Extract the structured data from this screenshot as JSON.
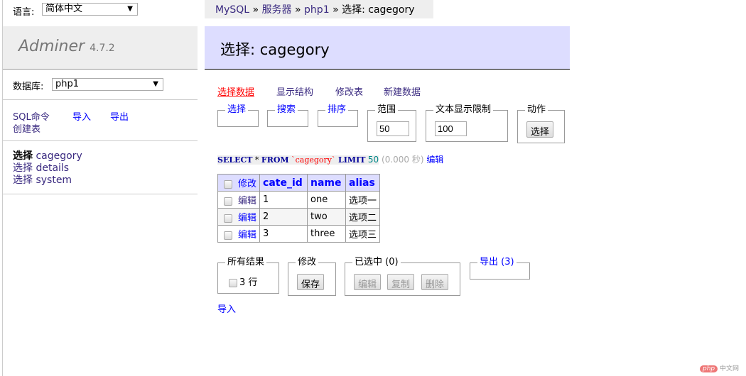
{
  "sidebar": {
    "lang_label": "语言:",
    "lang_value": "简体中文",
    "logo": "Adminer",
    "version": "4.7.2",
    "db_label": "数据库:",
    "db_value": "php1",
    "links": [
      "SQL命令",
      "导入",
      "导出",
      "创建表"
    ],
    "tables": [
      {
        "action": "选择",
        "name": "cagegory"
      },
      {
        "action": "选择",
        "name": "details"
      },
      {
        "action": "选择",
        "name": "system"
      }
    ]
  },
  "breadcrumb": {
    "items": [
      "MySQL",
      "服务器",
      "php1"
    ],
    "sep": "»",
    "current": "选择: cagegory"
  },
  "title": "选择: cagegory",
  "tabs": [
    "选择数据",
    "显示结构",
    "修改表",
    "新建数据"
  ],
  "filters": {
    "select": "选择",
    "search": "搜索",
    "sort": "排序",
    "limit_label": "范围",
    "limit_value": "50",
    "text_label": "文本显示限制",
    "text_value": "100",
    "action_label": "动作",
    "action_button": "选择"
  },
  "query": {
    "select": "SELECT",
    "star": "*",
    "from": "FROM",
    "table": "`cagegory`",
    "limit": "LIMIT",
    "limit_value": "50",
    "time": "(0.000 秒)",
    "edit": "编辑"
  },
  "table": {
    "modify_header": "修改",
    "columns": [
      "cate_id",
      "name",
      "alias"
    ],
    "rows": [
      {
        "edit": "编辑",
        "cells": [
          "1",
          "one",
          "选项一"
        ]
      },
      {
        "edit": "编辑",
        "cells": [
          "2",
          "two",
          "选项二"
        ]
      },
      {
        "edit": "编辑",
        "cells": [
          "3",
          "three",
          "选项三"
        ]
      }
    ]
  },
  "bottom": {
    "all_label": "所有结果",
    "rows_label": "3 行",
    "modify_label": "修改",
    "save": "保存",
    "selected_label": "已选中 (0)",
    "edit": "编辑",
    "copy": "复制",
    "delete": "删除",
    "export": "导出 (3)",
    "import": "导入"
  },
  "watermark": "php中文网"
}
